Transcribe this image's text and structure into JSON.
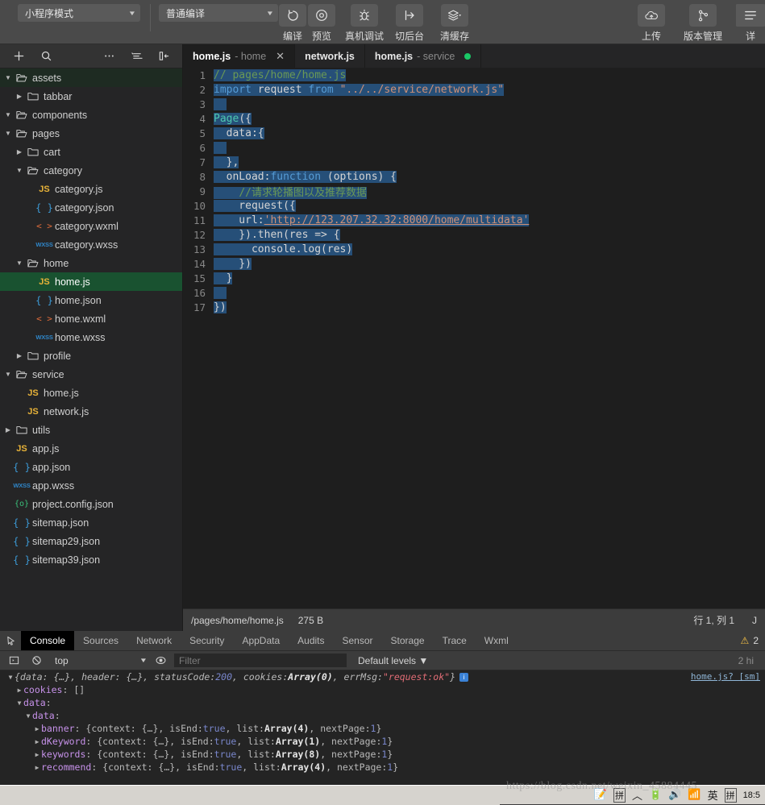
{
  "toolbar": {
    "mode_select": {
      "value": "小程序模式",
      "name": "mode-select"
    },
    "compile_select": {
      "value": "普通编译"
    },
    "buttons": [
      {
        "label": "编译",
        "icon": "refresh-icon"
      },
      {
        "label": "预览",
        "icon": "eye-icon"
      },
      {
        "label": "真机调试",
        "icon": "bug-icon"
      },
      {
        "label": "切后台",
        "icon": "background-icon"
      },
      {
        "label": "清缓存",
        "icon": "layers-icon"
      },
      {
        "label": "上传",
        "icon": "upload-cloud-icon"
      },
      {
        "label": "版本管理",
        "icon": "branch-icon"
      },
      {
        "label": "详",
        "icon": "detail-icon"
      }
    ]
  },
  "sidebar": {
    "tools": [
      "add-icon",
      "search-icon",
      "more-icon",
      "sort-icon",
      "collapse-icon"
    ],
    "tree": [
      {
        "indent": 0,
        "arrow": "down",
        "icon": "folder-open",
        "name": "assets",
        "state": "dirhdr"
      },
      {
        "indent": 1,
        "arrow": "right",
        "icon": "folder",
        "name": "tabbar",
        "state": ""
      },
      {
        "indent": 0,
        "arrow": "down",
        "icon": "folder-open",
        "name": "components",
        "state": ""
      },
      {
        "indent": 0,
        "arrow": "down",
        "icon": "folder-open",
        "name": "pages",
        "state": ""
      },
      {
        "indent": 1,
        "arrow": "right",
        "icon": "folder",
        "name": "cart",
        "state": ""
      },
      {
        "indent": 1,
        "arrow": "down",
        "icon": "folder-open",
        "name": "category",
        "state": ""
      },
      {
        "indent": 2,
        "arrow": "none",
        "icon": "js",
        "name": "category.js",
        "state": ""
      },
      {
        "indent": 2,
        "arrow": "none",
        "icon": "json",
        "name": "category.json",
        "state": ""
      },
      {
        "indent": 2,
        "arrow": "none",
        "icon": "wxml",
        "name": "category.wxml",
        "state": ""
      },
      {
        "indent": 2,
        "arrow": "none",
        "icon": "wxss",
        "name": "category.wxss",
        "state": ""
      },
      {
        "indent": 1,
        "arrow": "down",
        "icon": "folder-open",
        "name": "home",
        "state": ""
      },
      {
        "indent": 2,
        "arrow": "none",
        "icon": "js",
        "name": "home.js",
        "state": "sel"
      },
      {
        "indent": 2,
        "arrow": "none",
        "icon": "json",
        "name": "home.json",
        "state": ""
      },
      {
        "indent": 2,
        "arrow": "none",
        "icon": "wxml",
        "name": "home.wxml",
        "state": ""
      },
      {
        "indent": 2,
        "arrow": "none",
        "icon": "wxss",
        "name": "home.wxss",
        "state": ""
      },
      {
        "indent": 1,
        "arrow": "right",
        "icon": "folder",
        "name": "profile",
        "state": ""
      },
      {
        "indent": 0,
        "arrow": "down",
        "icon": "folder-open",
        "name": "service",
        "state": ""
      },
      {
        "indent": 1,
        "arrow": "none",
        "icon": "js",
        "name": "home.js",
        "state": ""
      },
      {
        "indent": 1,
        "arrow": "none",
        "icon": "js",
        "name": "network.js",
        "state": ""
      },
      {
        "indent": 0,
        "arrow": "right",
        "icon": "folder",
        "name": "utils",
        "state": ""
      },
      {
        "indent": 0,
        "arrow": "none",
        "icon": "js",
        "name": "app.js",
        "state": ""
      },
      {
        "indent": 0,
        "arrow": "none",
        "icon": "json",
        "name": "app.json",
        "state": ""
      },
      {
        "indent": 0,
        "arrow": "none",
        "icon": "wxss",
        "name": "app.wxss",
        "state": ""
      },
      {
        "indent": 0,
        "arrow": "none",
        "icon": "cfg",
        "name": "project.config.json",
        "state": ""
      },
      {
        "indent": 0,
        "arrow": "none",
        "icon": "json",
        "name": "sitemap.json",
        "state": ""
      },
      {
        "indent": 0,
        "arrow": "none",
        "icon": "json",
        "name": "sitemap29.json",
        "state": ""
      },
      {
        "indent": 0,
        "arrow": "none",
        "icon": "json",
        "name": "sitemap39.json",
        "state": ""
      }
    ]
  },
  "editor": {
    "tabs": [
      {
        "base": "home.js",
        "sub": "- home",
        "active": true,
        "close": "✕",
        "dot": false
      },
      {
        "base": "network.js",
        "sub": "",
        "active": false,
        "close": "",
        "dot": false
      },
      {
        "base": "home.js",
        "sub": "- service",
        "active": false,
        "close": "",
        "dot": true
      }
    ],
    "lines": [
      {
        "n": "1",
        "text": "// pages/home/home.js"
      },
      {
        "n": "2",
        "text": "import request from \"../../service/network.js\""
      },
      {
        "n": "3",
        "text": ""
      },
      {
        "n": "4",
        "text": "Page({"
      },
      {
        "n": "5",
        "text": "  data:{"
      },
      {
        "n": "6",
        "text": ""
      },
      {
        "n": "7",
        "text": "  },"
      },
      {
        "n": "8",
        "text": "  onLoad:function (options) {"
      },
      {
        "n": "9",
        "text": "    //请求轮播图以及推荐数据"
      },
      {
        "n": "10",
        "text": "    request({"
      },
      {
        "n": "11",
        "text": "    url:'http://123.207.32.32:8000/home/multidata'"
      },
      {
        "n": "12",
        "text": "    }).then(res => {"
      },
      {
        "n": "13",
        "text": "      console.log(res)"
      },
      {
        "n": "14",
        "text": "    })"
      },
      {
        "n": "15",
        "text": "  }"
      },
      {
        "n": "16",
        "text": ""
      },
      {
        "n": "17",
        "text": "})"
      }
    ],
    "status": {
      "file_path": "/pages/home/home.js",
      "file_size": "275 B",
      "position": "行 1, 列 1",
      "language": "J"
    }
  },
  "devtools": {
    "tabs": [
      {
        "label": "Console",
        "active": true
      },
      {
        "label": "Sources",
        "active": false
      },
      {
        "label": "Network",
        "active": false
      },
      {
        "label": "Security",
        "active": false
      },
      {
        "label": "AppData",
        "active": false
      },
      {
        "label": "Audits",
        "active": false
      },
      {
        "label": "Sensor",
        "active": false
      },
      {
        "label": "Storage",
        "active": false
      },
      {
        "label": "Trace",
        "active": false
      },
      {
        "label": "Wxml",
        "active": false
      }
    ],
    "warning_count": "2",
    "filter": {
      "context": "top",
      "placeholder": "Filter",
      "value": "",
      "levels": "Default levels",
      "hidden_text": "2 hi"
    },
    "console": {
      "source_link": "home.js? [sm]",
      "rows": [
        {
          "indent": 0,
          "tri": "down",
          "segments": [
            {
              "t": "{data: {…}, header: {…}, statusCode: ",
              "c": "c-dim it"
            },
            {
              "t": "200",
              "c": "c-num it"
            },
            {
              "t": ", cookies: ",
              "c": "c-dim it"
            },
            {
              "t": "Array(0)",
              "c": "c-bold it"
            },
            {
              "t": ", errMsg: ",
              "c": "c-dim it"
            },
            {
              "t": "\"request:ok\"",
              "c": "c-str it"
            },
            {
              "t": "}",
              "c": "c-dim it"
            }
          ],
          "badge": "i"
        },
        {
          "indent": 1,
          "tri": "right",
          "segments": [
            {
              "t": "cookies",
              "c": "c-key"
            },
            {
              "t": ": []",
              "c": "c-dim"
            }
          ],
          "badge": ""
        },
        {
          "indent": 1,
          "tri": "down",
          "segments": [
            {
              "t": "data",
              "c": "c-key"
            },
            {
              "t": ":",
              "c": "c-dim"
            }
          ],
          "badge": ""
        },
        {
          "indent": 2,
          "tri": "down",
          "segments": [
            {
              "t": "data",
              "c": "c-key"
            },
            {
              "t": ":",
              "c": "c-dim"
            }
          ],
          "badge": ""
        },
        {
          "indent": 3,
          "tri": "right",
          "segments": [
            {
              "t": "banner",
              "c": "c-key"
            },
            {
              "t": ": {context: {…}, isEnd: ",
              "c": "c-dim"
            },
            {
              "t": "true",
              "c": "c-num"
            },
            {
              "t": ", list: ",
              "c": "c-dim"
            },
            {
              "t": "Array(4)",
              "c": "c-bold"
            },
            {
              "t": ", nextPage: ",
              "c": "c-dim"
            },
            {
              "t": "1",
              "c": "c-num"
            },
            {
              "t": "}",
              "c": "c-dim"
            }
          ],
          "badge": ""
        },
        {
          "indent": 3,
          "tri": "right",
          "segments": [
            {
              "t": "dKeyword",
              "c": "c-key"
            },
            {
              "t": ": {context: {…}, isEnd: ",
              "c": "c-dim"
            },
            {
              "t": "true",
              "c": "c-num"
            },
            {
              "t": ", list: ",
              "c": "c-dim"
            },
            {
              "t": "Array(1)",
              "c": "c-bold"
            },
            {
              "t": ", nextPage: ",
              "c": "c-dim"
            },
            {
              "t": "1",
              "c": "c-num"
            },
            {
              "t": "}",
              "c": "c-dim"
            }
          ],
          "badge": ""
        },
        {
          "indent": 3,
          "tri": "right",
          "segments": [
            {
              "t": "keywords",
              "c": "c-key"
            },
            {
              "t": ": {context: {…}, isEnd: ",
              "c": "c-dim"
            },
            {
              "t": "true",
              "c": "c-num"
            },
            {
              "t": ", list: ",
              "c": "c-dim"
            },
            {
              "t": "Array(8)",
              "c": "c-bold"
            },
            {
              "t": ", nextPage: ",
              "c": "c-dim"
            },
            {
              "t": "1",
              "c": "c-num"
            },
            {
              "t": "}",
              "c": "c-dim"
            }
          ],
          "badge": ""
        },
        {
          "indent": 3,
          "tri": "right",
          "segments": [
            {
              "t": "recommend",
              "c": "c-key"
            },
            {
              "t": ": {context: {…}, isEnd: ",
              "c": "c-dim"
            },
            {
              "t": "true",
              "c": "c-num"
            },
            {
              "t": ", list: ",
              "c": "c-dim"
            },
            {
              "t": "Array(4)",
              "c": "c-bold"
            },
            {
              "t": ", nextPage: ",
              "c": "c-dim"
            },
            {
              "t": "1",
              "c": "c-num"
            },
            {
              "t": "}",
              "c": "c-dim"
            }
          ],
          "badge": ""
        }
      ]
    }
  },
  "taskbar": {
    "tray": [
      "ime-pad-icon",
      "ime-pin-icon",
      "caret-icon",
      "battery-icon",
      "volume-icon",
      "network-icon",
      "lang-en",
      "ime-pin2-icon"
    ],
    "clock": "18:5"
  },
  "watermark": "https://blog.csdn.net/weixin_45884445"
}
